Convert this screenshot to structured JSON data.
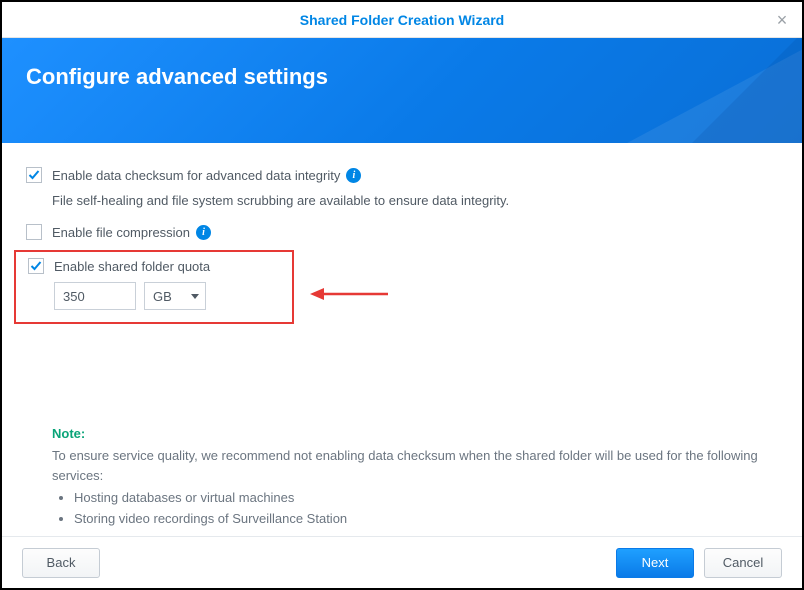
{
  "window": {
    "title": "Shared Folder Creation Wizard"
  },
  "header": {
    "title": "Configure advanced settings"
  },
  "options": {
    "checksum": {
      "label": "Enable data checksum for advanced data integrity",
      "checked": true,
      "description": "File self-healing and file system scrubbing are available to ensure data integrity."
    },
    "compression": {
      "label": "Enable file compression",
      "checked": false
    },
    "quota": {
      "label": "Enable shared folder quota",
      "checked": true,
      "value": "350",
      "unit": "GB"
    }
  },
  "note": {
    "label": "Note:",
    "text": "To ensure service quality, we recommend not enabling data checksum when the shared folder will be used for the following services:",
    "items": [
      "Hosting databases or virtual machines",
      "Storing video recordings of Surveillance Station"
    ]
  },
  "buttons": {
    "back": "Back",
    "next": "Next",
    "cancel": "Cancel"
  }
}
